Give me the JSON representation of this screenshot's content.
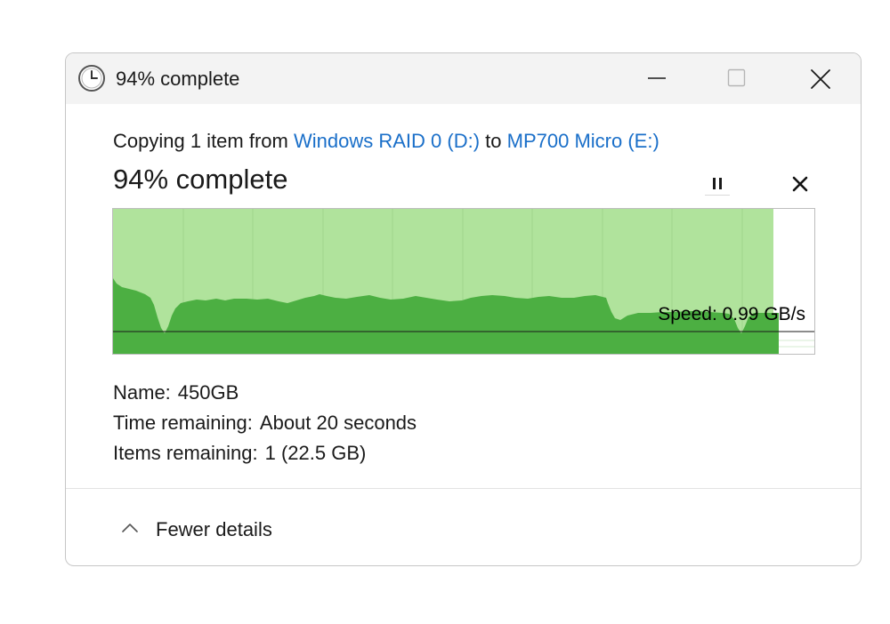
{
  "window": {
    "title": "94% complete",
    "icons": {
      "title": "clock-icon",
      "minimize": "minimize-icon",
      "maximize": "maximize-icon",
      "close": "close-icon"
    }
  },
  "copy": {
    "prefix": "Copying 1 item from",
    "source": "Windows RAID 0 (D:)",
    "connector": "to",
    "destination": "MP700 Micro (E:)",
    "progress_title": "94% complete",
    "progress_percent": 94,
    "link_color": "#1a6fc9"
  },
  "controls": {
    "pause_icon": "pause-icon",
    "cancel_icon": "cancel-icon"
  },
  "graph": {
    "speed_text": "Speed: 0.99 GB/s",
    "fill_color": "#4caf42",
    "background_fill_color": "#b0e39c"
  },
  "details": {
    "name_label": "Name:",
    "name_value": "450GB",
    "time_label": "Time remaining:",
    "time_value": "About 20 seconds",
    "items_label": "Items remaining:",
    "items_value": "1 (22.5 GB)"
  },
  "footer": {
    "toggle_label": "Fewer details",
    "toggle_icon": "chevron-up-icon"
  }
}
